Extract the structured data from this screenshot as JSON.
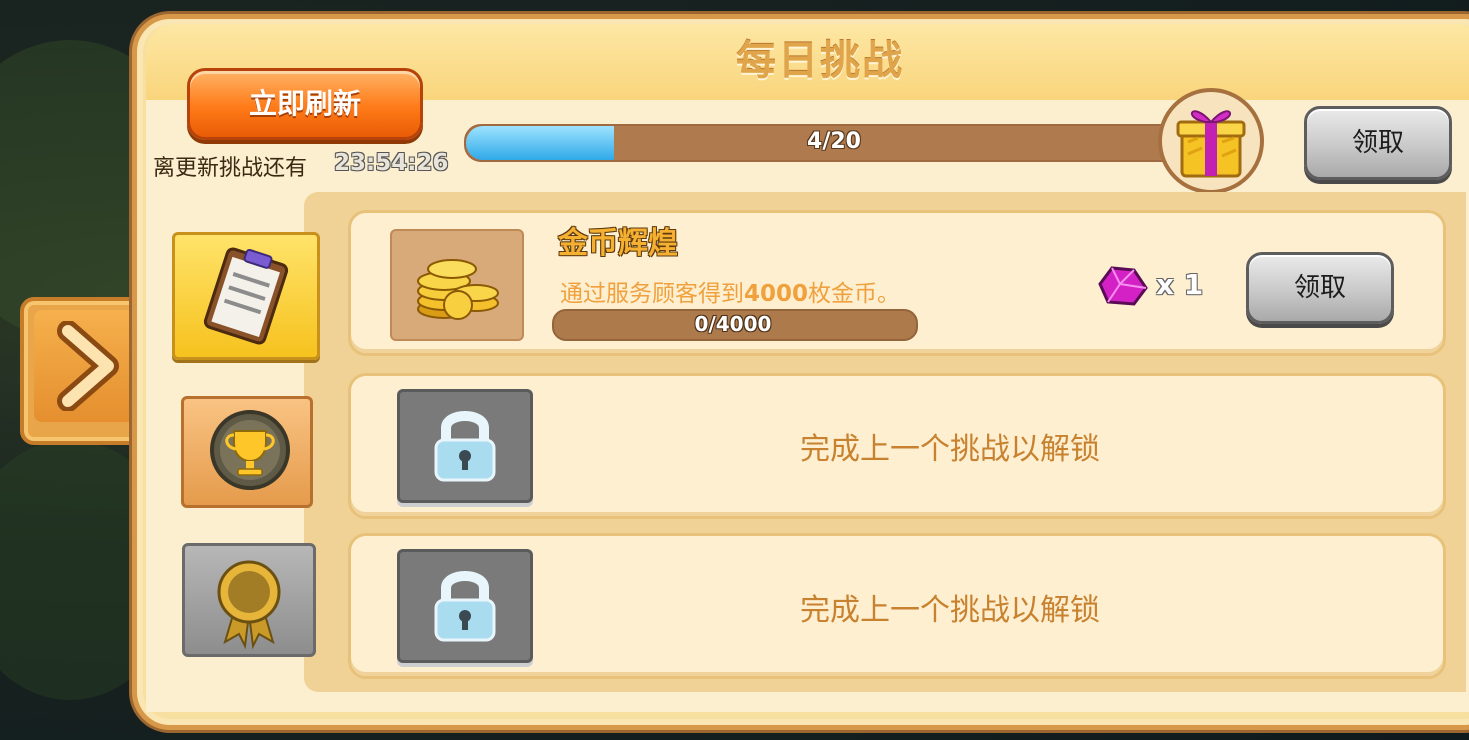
{
  "header": {
    "title": "每日挑战",
    "refresh_label": "立即刷新",
    "countdown_label": "离更新挑战还有",
    "countdown_time": "23:54:26"
  },
  "progress": {
    "current": 4,
    "total": 20,
    "label": "4/20",
    "fraction": 0.2,
    "claim_label": "领取"
  },
  "tabs": [
    {
      "name": "daily-tasks",
      "icon": "clipboard-icon",
      "state": "active"
    },
    {
      "name": "achievements",
      "icon": "trophy-icon",
      "state": "normal"
    },
    {
      "name": "badges",
      "icon": "medal-icon",
      "state": "disabled"
    }
  ],
  "challenges": [
    {
      "title": "金币辉煌",
      "desc_prefix": "通过服务顾客得到",
      "desc_amount": "4000",
      "desc_suffix": "枚金币。",
      "progress_label": "0/4000",
      "progress_fraction": 0.0,
      "reward_icon": "gem-icon",
      "reward_qty": "x 1",
      "claim_label": "领取"
    },
    {
      "locked_text": "完成上一个挑战以解锁",
      "icon": "lock-icon"
    },
    {
      "locked_text": "完成上一个挑战以解锁",
      "icon": "lock-icon"
    }
  ],
  "colors": {
    "panel": "#f7dfa0",
    "accent_orange": "#ff7a18",
    "progress_blue": "#2fa9e8",
    "locked_text": "#c8822f"
  }
}
